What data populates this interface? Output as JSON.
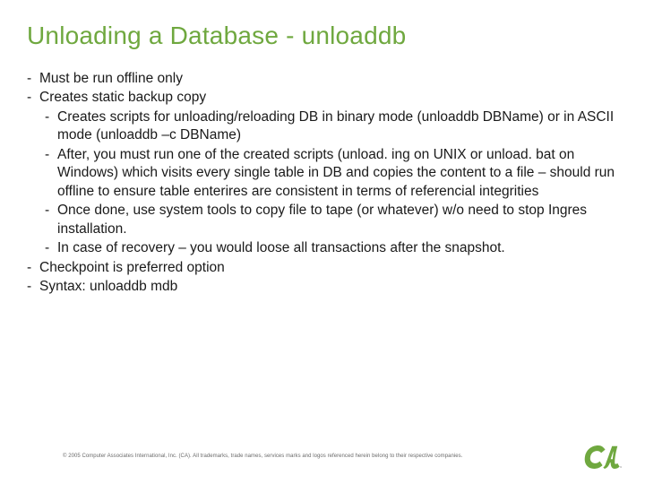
{
  "title": "Unloading a Database - unloaddb",
  "bullets": {
    "b1": "Must be run offline only",
    "b2": "Creates static backup copy",
    "b2_1": "Creates scripts for unloading/reloading DB in binary mode (unloaddb DBName) or in ASCII mode (unloaddb –c DBName)",
    "b2_2": "After, you must run one of the created scripts (unload. ing on UNIX or unload. bat on Windows) which visits every single table in DB and copies the content to a file – should run offline to ensure table enterires are consistent in terms of referencial integrities",
    "b2_3": "Once done, use system tools to copy file to tape (or whatever) w/o need to stop Ingres installation.",
    "b2_4": "In case of recovery – you would loose all transactions after the snapshot.",
    "b3": "Checkpoint is preferred option",
    "b4": "Syntax: unloaddb mdb"
  },
  "footer": "© 2005 Computer Associates International, Inc. (CA). All trademarks, trade names, services marks and logos referenced herein belong to their respective companies.",
  "logo_name": "ca"
}
